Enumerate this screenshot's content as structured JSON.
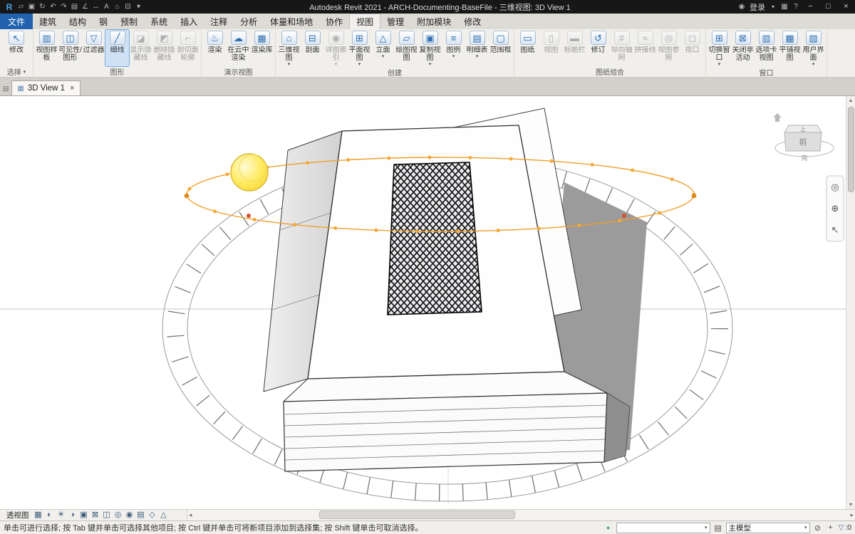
{
  "titlebar": {
    "logo": "R",
    "title": "Autodesk Revit 2021 - ARCH-Documenting-BaseFile - 三维视图: 3D View 1",
    "qat": [
      {
        "name": "open",
        "glyph": "▱"
      },
      {
        "name": "save",
        "glyph": "▣"
      },
      {
        "name": "sync-with-central",
        "glyph": "↻"
      },
      {
        "name": "undo",
        "glyph": "↶"
      },
      {
        "name": "redo",
        "glyph": "↷"
      },
      {
        "name": "print",
        "glyph": "▤"
      },
      {
        "name": "measure",
        "glyph": "∠"
      },
      {
        "name": "aligned-dimension",
        "glyph": "↔"
      },
      {
        "name": "text",
        "glyph": "A"
      },
      {
        "name": "default-3d-view",
        "glyph": "⌂"
      },
      {
        "name": "section",
        "glyph": "⊟"
      },
      {
        "name": "customize",
        "glyph": "▾"
      }
    ],
    "right": {
      "login": "登录",
      "help": "?",
      "min": "−",
      "max": "□",
      "close": "×"
    }
  },
  "tabs": {
    "file": "文件",
    "items": [
      {
        "name": "architecture",
        "label": "建筑"
      },
      {
        "name": "structure",
        "label": "结构"
      },
      {
        "name": "steel",
        "label": "钢"
      },
      {
        "name": "precast",
        "label": "预制"
      },
      {
        "name": "systems",
        "label": "系统"
      },
      {
        "name": "insert",
        "label": "插入"
      },
      {
        "name": "annotate",
        "label": "注释"
      },
      {
        "name": "analyze",
        "label": "分析"
      },
      {
        "name": "massing-site",
        "label": "体量和场地"
      },
      {
        "name": "collaborate",
        "label": "协作"
      },
      {
        "name": "view",
        "label": "视图",
        "active": true
      },
      {
        "name": "manage",
        "label": "管理"
      },
      {
        "name": "addins",
        "label": "附加模块"
      },
      {
        "name": "modify",
        "label": "修改"
      }
    ]
  },
  "ribbon": {
    "panels": [
      {
        "name": "选择",
        "buttons": [
          {
            "name": "modify",
            "label": "修改",
            "glyph": "↖"
          }
        ]
      },
      {
        "name": "图形",
        "buttons": [
          {
            "name": "view-template",
            "label": "视图样板",
            "glyph": "▥"
          },
          {
            "name": "visibility-graphics",
            "label": "可见性/图形",
            "glyph": "◫"
          },
          {
            "name": "filters",
            "label": "过滤器",
            "glyph": "▽"
          },
          {
            "name": "thin-lines",
            "label": "细线",
            "glyph": "╱",
            "active": true
          },
          {
            "name": "show-hidden-lines",
            "label": "显示隐藏线",
            "glyph": "◪",
            "disabled": true
          },
          {
            "name": "remove-hidden-lines",
            "label": "删除隐藏线",
            "glyph": "◩",
            "disabled": true
          },
          {
            "name": "cut-profile",
            "label": "剖切面轮廓",
            "glyph": "⌐",
            "disabled": true
          }
        ]
      },
      {
        "name": "演示视图",
        "buttons": [
          {
            "name": "render",
            "label": "渲染",
            "glyph": "♨"
          },
          {
            "name": "render-in-cloud",
            "label": "在云中渲染",
            "glyph": "☁"
          },
          {
            "name": "render-gallery",
            "label": "渲染库",
            "glyph": "▦"
          }
        ]
      },
      {
        "name": "创建",
        "buttons": [
          {
            "name": "3d-view",
            "label": "三维视图",
            "glyph": "⌂",
            "arrow": true
          },
          {
            "name": "section",
            "label": "剖面",
            "glyph": "⊟"
          },
          {
            "name": "callout",
            "label": "详图索引",
            "glyph": "◉",
            "disabled": true,
            "arrow": true
          },
          {
            "name": "plan-views",
            "label": "平面视图",
            "glyph": "⊞",
            "arrow": true
          },
          {
            "name": "elevation",
            "label": "立面",
            "glyph": "△",
            "arrow": true
          },
          {
            "name": "drafting-view",
            "label": "绘图视图",
            "glyph": "▱"
          },
          {
            "name": "duplicate-view",
            "label": "复制视图",
            "glyph": "▣",
            "arrow": true
          },
          {
            "name": "legends",
            "label": "图例",
            "glyph": "≡",
            "arrow": true
          },
          {
            "name": "schedules",
            "label": "明细表",
            "glyph": "▤",
            "arrow": true
          },
          {
            "name": "scope-box",
            "label": "范围框",
            "glyph": "▢"
          }
        ]
      },
      {
        "name": "图纸组合",
        "buttons": [
          {
            "name": "sheet",
            "label": "图纸",
            "glyph": "▭"
          },
          {
            "name": "view",
            "label": "视图",
            "glyph": "▯",
            "disabled": true
          },
          {
            "name": "title-block",
            "label": "标题栏",
            "glyph": "▬",
            "disabled": true
          },
          {
            "name": "revisions",
            "label": "修订",
            "glyph": "↺"
          },
          {
            "name": "guide-grid",
            "label": "导向轴网",
            "glyph": "#",
            "disabled": true
          },
          {
            "name": "matchline",
            "label": "拼接线",
            "glyph": "≈",
            "disabled": true
          },
          {
            "name": "view-reference",
            "label": "视图参照",
            "glyph": "◎",
            "disabled": true
          },
          {
            "name": "viewports",
            "label": "视口",
            "glyph": "◻",
            "disabled": true
          }
        ]
      },
      {
        "name": "窗口",
        "buttons": [
          {
            "name": "switch-windows",
            "label": "切换窗口",
            "glyph": "⊞",
            "arrow": true
          },
          {
            "name": "close-inactive",
            "label": "关闭非活动",
            "glyph": "⊠"
          },
          {
            "name": "tab-views",
            "label": "选项卡视图",
            "glyph": "▥"
          },
          {
            "name": "tile-views",
            "label": "平铺视图",
            "glyph": "▦"
          },
          {
            "name": "user-interface",
            "label": "用户界面",
            "glyph": "▧",
            "arrow": true
          }
        ]
      }
    ]
  },
  "viewtab": {
    "label": "3D View 1"
  },
  "viewport": {
    "viewcube": {
      "top": "上",
      "front": "前",
      "south": "南"
    },
    "navbar": [
      {
        "name": "steering-wheel",
        "glyph": "◎"
      },
      {
        "name": "zoom",
        "glyph": "⊕"
      },
      {
        "name": "previous-view",
        "glyph": "↖"
      }
    ]
  },
  "view_controls": {
    "scale": "透视图",
    "icons": [
      {
        "name": "detail-level",
        "glyph": "▦"
      },
      {
        "name": "visual-style",
        "glyph": "◐"
      },
      {
        "name": "sun-path",
        "glyph": "☀"
      },
      {
        "name": "shadows",
        "glyph": "◑"
      },
      {
        "name": "show-rendering-dialog",
        "glyph": "▣"
      },
      {
        "name": "crop-view",
        "glyph": "⊠"
      },
      {
        "name": "show-crop-region",
        "glyph": "◫"
      },
      {
        "name": "temporary-hide-isolate",
        "glyph": "◎"
      },
      {
        "name": "reveal-hidden-elements",
        "glyph": "◉"
      },
      {
        "name": "temporary-view-properties",
        "glyph": "▤"
      },
      {
        "name": "show-analytical-model",
        "glyph": "◇"
      },
      {
        "name": "highlight-displacement-sets",
        "glyph": "△"
      }
    ]
  },
  "statusbar": {
    "message": "单击可进行选择; 按 Tab 键并单击可选择其他项目; 按 Ctrl 键并单击可将新项目添加到选择集; 按 Shift 键单击可取消选择。",
    "design_option": "主模型",
    "filter_count": ":0"
  }
}
